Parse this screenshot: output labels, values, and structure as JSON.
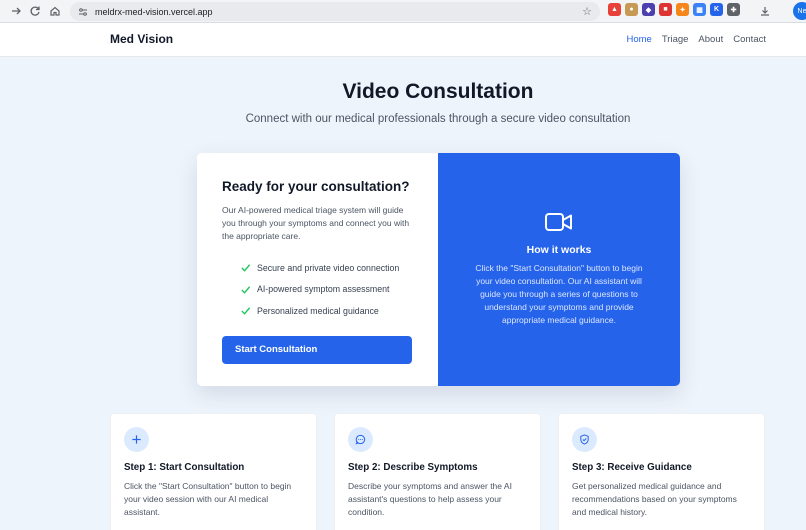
{
  "browser": {
    "url": "meldrx-med-vision.vercel.app",
    "profile_initials": "Ne",
    "extensions": [
      {
        "name": "brave-shield-icon",
        "color": "#e8413a",
        "glyph": "▲"
      },
      {
        "name": "cookie-icon",
        "color": "#c69a55",
        "glyph": "●"
      },
      {
        "name": "shield-extension-icon",
        "color": "#4c3fb0",
        "glyph": "◆"
      },
      {
        "name": "flag-extension-icon",
        "color": "#d33",
        "glyph": "■"
      },
      {
        "name": "metamask-fox-icon",
        "color": "#f6851b",
        "glyph": "✦"
      },
      {
        "name": "grid-extension-icon",
        "color": "#3b82f6",
        "glyph": "▦"
      },
      {
        "name": "k-extension-icon",
        "color": "#2563eb",
        "glyph": "K"
      },
      {
        "name": "puzzle-extensions-icon",
        "color": "#5f6368",
        "glyph": "✚"
      }
    ]
  },
  "header": {
    "brand": "Med Vision",
    "nav": [
      {
        "label": "Home",
        "active": true
      },
      {
        "label": "Triage",
        "active": false
      },
      {
        "label": "About",
        "active": false
      },
      {
        "label": "Contact",
        "active": false
      }
    ]
  },
  "hero": {
    "title": "Video Consultation",
    "subtitle": "Connect with our medical professionals through a secure video consultation"
  },
  "consultation_card": {
    "heading": "Ready for your consultation?",
    "description": "Our AI-powered medical triage system will guide you through your symptoms and connect you with the appropriate care.",
    "features": [
      "Secure and private video connection",
      "AI-powered symptom assessment",
      "Personalized medical guidance"
    ],
    "button_label": "Start Consultation",
    "how_it_works": {
      "heading": "How it works",
      "text": "Click the \"Start Consultation\" button to begin your video consultation. Our AI assistant will guide you through a series of questions to understand your symptoms and provide appropriate medical guidance."
    }
  },
  "steps": [
    {
      "icon": "plus-icon",
      "title": "Step 1: Start Consultation",
      "text": "Click the \"Start Consultation\" button to begin your video session with our AI medical assistant."
    },
    {
      "icon": "chat-bubble-icon",
      "title": "Step 2: Describe Symptoms",
      "text": "Describe your symptoms and answer the AI assistant's questions to help assess your condition."
    },
    {
      "icon": "shield-check-icon",
      "title": "Step 3: Receive Guidance",
      "text": "Get personalized medical guidance and recommendations based on your symptoms and medical history."
    }
  ],
  "colors": {
    "primary": "#2563eb",
    "background": "#eef4fb",
    "check_green": "#22c55e"
  }
}
